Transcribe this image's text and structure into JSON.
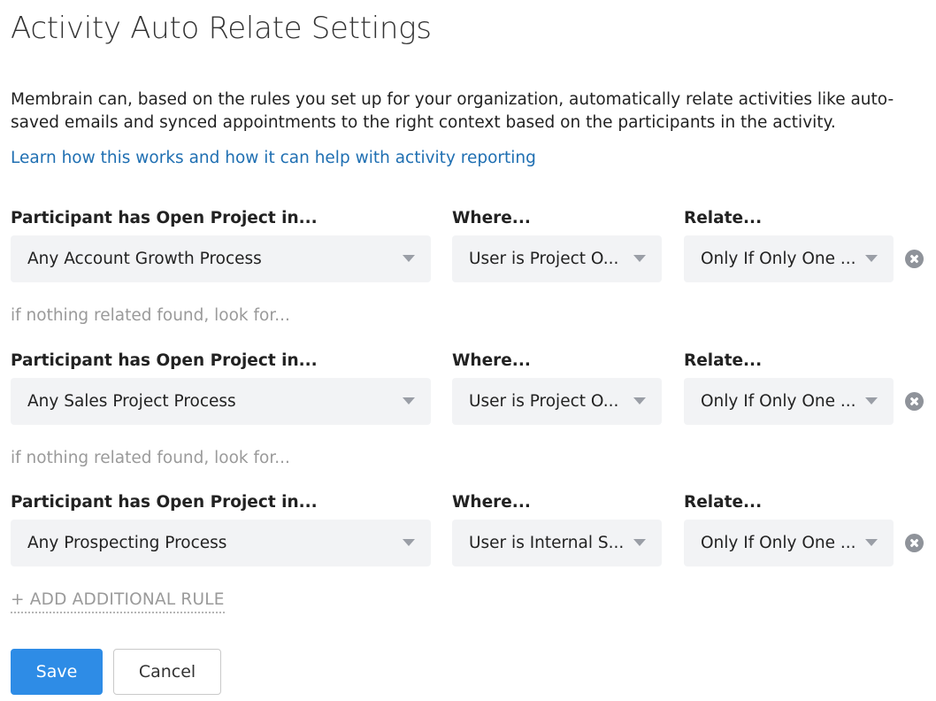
{
  "page": {
    "title": "Activity Auto Relate Settings",
    "description": "Membrain can, based on the rules you set up for your organization, automatically relate activities like auto-saved emails and synced appointments to the right context based on the participants in the activity.",
    "help_link": "Learn how this works and how it can help with activity reporting"
  },
  "columns": {
    "project": "Participant has Open Project in...",
    "where": "Where...",
    "relate": "Relate..."
  },
  "rules": [
    {
      "project_value": "Any Account Growth Process",
      "where_value": "User is Project O...",
      "relate_value": "Only If Only One ..."
    },
    {
      "project_value": "Any Sales Project Process",
      "where_value": "User is Project O...",
      "relate_value": "Only If Only One ..."
    },
    {
      "project_value": "Any Prospecting Process",
      "where_value": "User is Internal S...",
      "relate_value": "Only If Only One ..."
    }
  ],
  "fallback_text": "if nothing related found, look for...",
  "actions": {
    "add_rule": "+ ADD ADDITIONAL RULE",
    "save": "Save",
    "cancel": "Cancel"
  },
  "colors": {
    "link": "#1f6fb2",
    "primary_button": "#2e8ce6",
    "select_background": "#f2f3f5",
    "muted_text": "#9a9a9a"
  },
  "icons": {
    "dropdown": "chevron-down-icon",
    "remove": "close-circle-icon"
  }
}
